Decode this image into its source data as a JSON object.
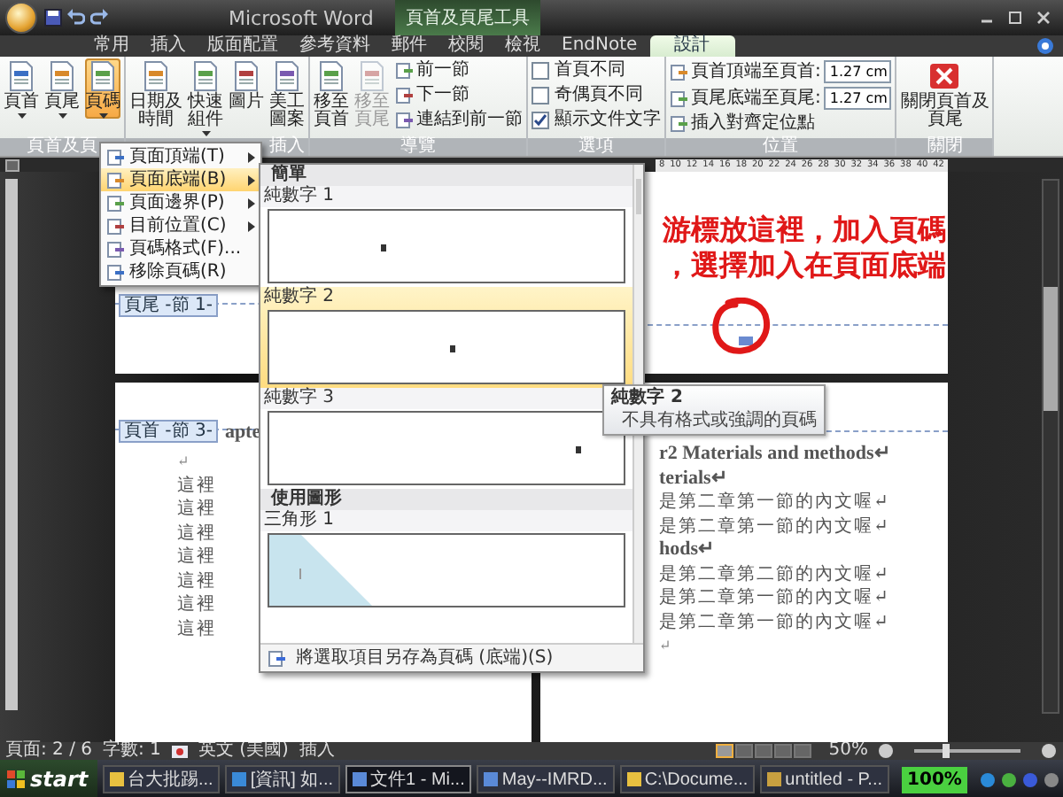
{
  "window": {
    "title": "Microsoft Word",
    "context_title": "頁首及頁尾工具"
  },
  "tabs": [
    {
      "label": "常用",
      "selected": false
    },
    {
      "label": "插入",
      "selected": false
    },
    {
      "label": "版面配置",
      "selected": false
    },
    {
      "label": "參考資料",
      "selected": false
    },
    {
      "label": "郵件",
      "selected": false
    },
    {
      "label": "校閱",
      "selected": false
    },
    {
      "label": "檢視",
      "selected": false
    },
    {
      "label": "EndNote",
      "selected": false
    },
    {
      "label": "設計",
      "selected": true
    }
  ],
  "ribbon": {
    "groups": [
      {
        "label": "頁首及頁",
        "items": [
          {
            "kind": "large",
            "label": "頁首",
            "dropdown": true,
            "selected": false
          },
          {
            "kind": "large",
            "label": "頁尾",
            "dropdown": true,
            "selected": false
          },
          {
            "kind": "large",
            "label": "頁碼",
            "dropdown": true,
            "selected": true
          }
        ]
      },
      {
        "label": "插入",
        "items": [
          {
            "kind": "large",
            "label": "日期及時間",
            "dropdown": false
          },
          {
            "kind": "large",
            "label": "快速組件",
            "dropdown": true
          },
          {
            "kind": "large",
            "label": "圖片",
            "dropdown": false
          },
          {
            "kind": "large",
            "label": "美工圖案",
            "dropdown": false
          }
        ]
      },
      {
        "label": "導覽",
        "items": [
          {
            "kind": "large",
            "label": "移至頁首",
            "disabled": false
          },
          {
            "kind": "large",
            "label": "移至頁尾",
            "disabled": true
          },
          {
            "kind": "small",
            "label": "前一節",
            "disabled": false
          },
          {
            "kind": "small",
            "label": "下一節",
            "disabled": false
          },
          {
            "kind": "small",
            "label": "連結到前一節",
            "disabled": false
          }
        ]
      },
      {
        "label": "選項",
        "items": [
          {
            "kind": "check",
            "label": "首頁不同",
            "checked": false
          },
          {
            "kind": "check",
            "label": "奇偶頁不同",
            "checked": false
          },
          {
            "kind": "check",
            "label": "顯示文件文字",
            "checked": true
          }
        ]
      },
      {
        "label": "位置",
        "items": [
          {
            "kind": "spin",
            "label": "頁首頂端至頁首:",
            "value": "1.27 cm"
          },
          {
            "kind": "spin",
            "label": "頁尾底端至頁尾:",
            "value": "1.27 cm"
          },
          {
            "kind": "small",
            "label": "插入對齊定位點"
          }
        ]
      },
      {
        "label": "關閉",
        "items": [
          {
            "kind": "close",
            "label": "關閉頁首及頁尾"
          }
        ]
      }
    ]
  },
  "ruler": {
    "numbers": [
      "8",
      "10",
      "12",
      "14",
      "16",
      "18",
      "20",
      "22",
      "24",
      "26",
      "28",
      "30",
      "32",
      "34",
      "36",
      "38",
      "40",
      "42"
    ]
  },
  "document": {
    "upper_left_page": {
      "footer_tag": "頁尾 -節 1-"
    },
    "lower_left_page": {
      "header_tag": "頁首 -節 3-",
      "heading_fragment": "apte",
      "lines": [
        {
          "kind": "mark",
          "text": "↵"
        },
        {
          "kind": "body",
          "text": "這裡"
        },
        {
          "kind": "body",
          "text": "這裡"
        },
        {
          "kind": "body",
          "text": "這裡"
        },
        {
          "kind": "body",
          "text": "這裡"
        },
        {
          "kind": "body",
          "text": "這裡"
        },
        {
          "kind": "body",
          "text": "這裡"
        },
        {
          "kind": "body",
          "text": "這裡"
        }
      ]
    },
    "lower_right_page": {
      "lines": [
        {
          "kind": "title",
          "text": "r2 Materials and methods↵"
        },
        {
          "kind": "title",
          "text": "terials↵"
        },
        {
          "kind": "body",
          "text": "是第二章第一節的內文喔↵"
        },
        {
          "kind": "body",
          "text": "是第二章第一節的內文喔↵"
        },
        {
          "kind": "title",
          "text": "hods↵"
        },
        {
          "kind": "body",
          "text": "是第二章第二節的內文喔↵"
        },
        {
          "kind": "body",
          "text": "是第二章第一節的內文喔↵"
        },
        {
          "kind": "body",
          "text": "是第二章第一節的內文喔↵"
        },
        {
          "kind": "mark",
          "text": "↵"
        }
      ]
    }
  },
  "menu": {
    "items": [
      {
        "label": "頁面頂端(T)",
        "submenu": true,
        "selected": false
      },
      {
        "label": "頁面底端(B)",
        "submenu": true,
        "selected": true
      },
      {
        "label": "頁面邊界(P)",
        "submenu": true,
        "selected": false
      },
      {
        "label": "目前位置(C)",
        "submenu": true,
        "selected": false
      },
      {
        "label": "頁碼格式(F)...",
        "submenu": false,
        "selected": false
      },
      {
        "label": "移除頁碼(R)",
        "submenu": false,
        "selected": false
      }
    ]
  },
  "gallery": {
    "sections": [
      {
        "title": "簡單",
        "items": [
          {
            "label": "純數字 1",
            "kind": "left",
            "selected": false
          },
          {
            "label": "純數字 2",
            "kind": "center",
            "selected": true
          },
          {
            "label": "純數字 3",
            "kind": "right",
            "selected": false
          }
        ]
      },
      {
        "title": "使用圖形",
        "items": [
          {
            "label": "三角形 1",
            "kind": "triangle",
            "selected": false
          }
        ]
      }
    ],
    "footer": "將選取項目另存為頁碼 (底端)(S)"
  },
  "tooltip": {
    "title": "純數字 2",
    "description": "不具有格式或強調的頁碼"
  },
  "annotation": {
    "lines": [
      "游標放這裡，加入頁碼",
      "，選擇加入在頁面底端"
    ]
  },
  "status_bar": {
    "page": "頁面: 2 / 6",
    "words": "字數: 1",
    "language": "英文 (美國)",
    "mode": "插入",
    "views": [
      {
        "selected": true
      },
      {
        "selected": false
      },
      {
        "selected": false
      },
      {
        "selected": false
      },
      {
        "selected": false
      }
    ],
    "zoom": "50%",
    "zoom_slider": {
      "level": 0.3
    }
  },
  "taskbar": {
    "start": "start",
    "buttons": [
      {
        "label": "台大批踢...",
        "selected": false
      },
      {
        "label": "[資訊] 如...",
        "selected": false
      },
      {
        "label": "文件1 - Mi...",
        "selected": true
      },
      {
        "label": "May--IMRD...",
        "selected": false
      },
      {
        "label": "C:\\Docume...",
        "selected": false
      },
      {
        "label": "untitled - P...",
        "selected": false
      }
    ],
    "badge": "100%"
  }
}
